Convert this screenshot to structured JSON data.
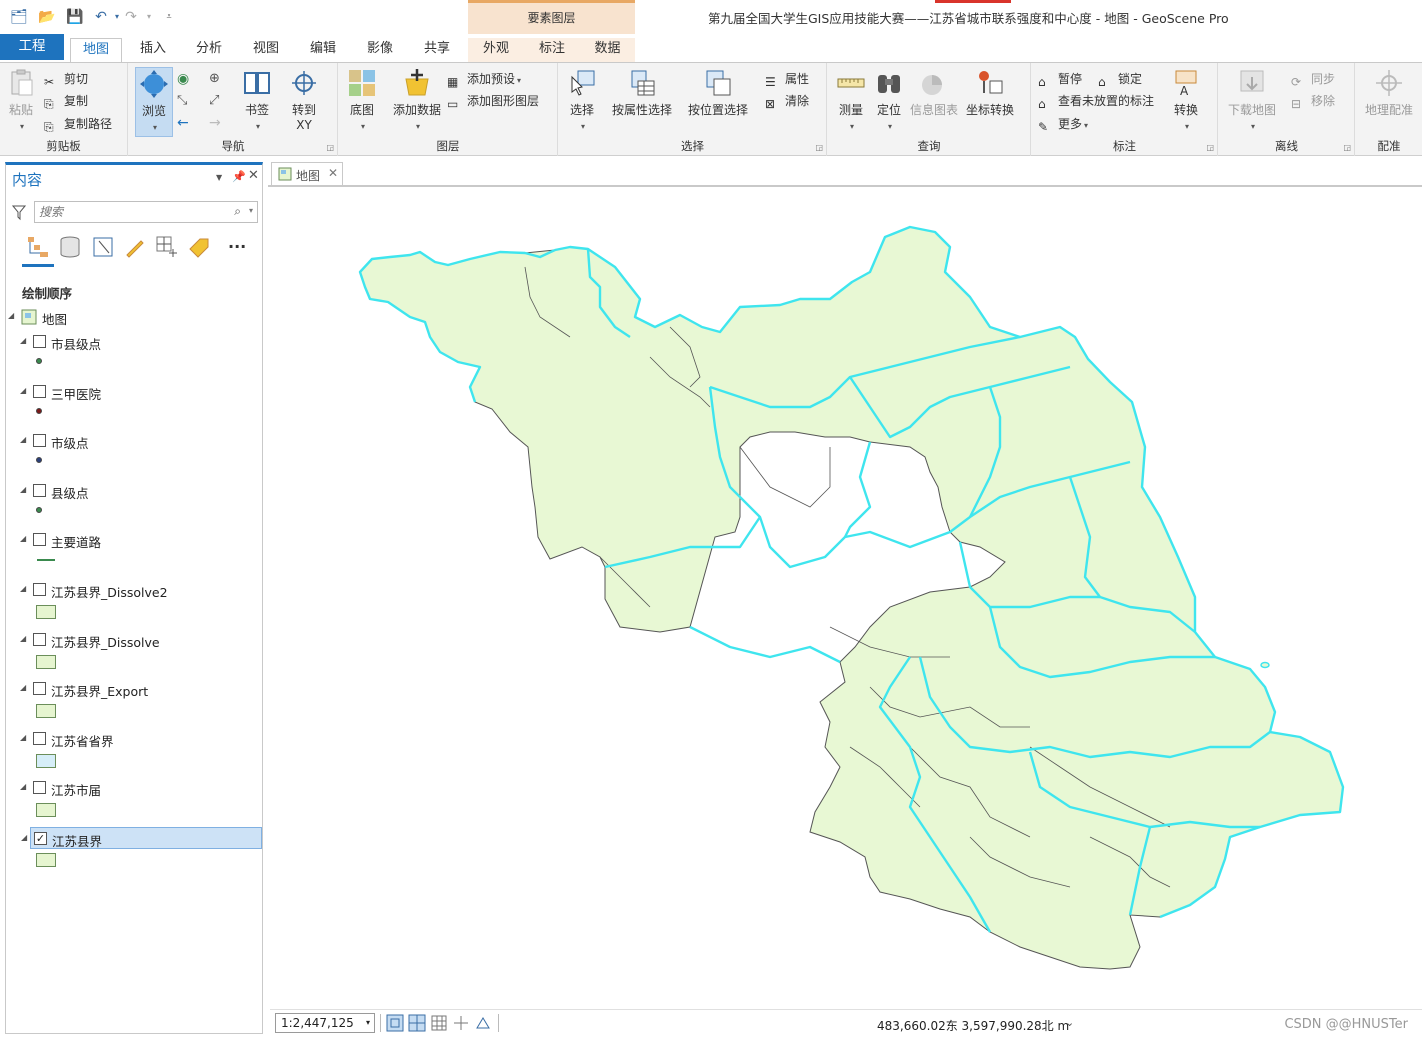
{
  "window": {
    "title": "第九届全国大学生GIS应用技能大赛——江苏省城市联系强度和中心度 - 地图 - GeoScene Pro",
    "contextual_group": "要素图层"
  },
  "tabs": {
    "project": "工程",
    "map": "地图",
    "insert": "插入",
    "analysis": "分析",
    "view": "视图",
    "edit": "编辑",
    "imagery": "影像",
    "share": "共享",
    "appearance": "外观",
    "labeling": "标注",
    "data": "数据"
  },
  "ribbon": {
    "clipboard": {
      "label": "剪贴板",
      "paste": "粘贴",
      "cut": "剪切",
      "copy": "复制",
      "copy_path": "复制路径"
    },
    "navigate": {
      "label": "导航",
      "explore": "浏览",
      "bookmarks": "书签",
      "goto_xy_1": "转到",
      "goto_xy_2": "XY"
    },
    "layer": {
      "label": "图层",
      "basemap": "底图",
      "add_data": "添加数据",
      "add_preset": "添加预设",
      "add_graphics_layer": "添加图形图层"
    },
    "selection": {
      "label": "选择",
      "select": "选择",
      "select_by_attributes": "按属性选择",
      "select_by_location": "按位置选择",
      "attributes": "属性",
      "clear": "清除"
    },
    "inquiry": {
      "label": "查询",
      "measure": "测量",
      "locate": "定位",
      "infographics": "信息图表",
      "convert_coordinates": "坐标转换"
    },
    "labeling": {
      "label": "标注",
      "pause": "暂停",
      "lock": "锁定",
      "view_unplaced": "查看未放置的标注",
      "more": "更多",
      "convert": "转换"
    },
    "offline": {
      "label": "离线",
      "download_map": "下载地图",
      "sync": "同步",
      "remove": "移除"
    },
    "georeference": {
      "label": "配准",
      "georeference": "地理配准"
    }
  },
  "contents": {
    "title": "内容",
    "search_placeholder": "搜索",
    "drawing_order": "绘制顺序",
    "map_name": "地图",
    "layers": [
      {
        "name": "市县级点",
        "checked": false,
        "symbol": "point",
        "color": "#3a8a4e"
      },
      {
        "name": "三甲医院",
        "checked": false,
        "symbol": "point",
        "color": "#7a1a1a"
      },
      {
        "name": "市级点",
        "checked": false,
        "symbol": "point",
        "color": "#2a3f7a"
      },
      {
        "name": "县级点",
        "checked": false,
        "symbol": "point",
        "color": "#3a8a4e"
      },
      {
        "name": "主要道路",
        "checked": false,
        "symbol": "line",
        "color": "#3a8a4e"
      },
      {
        "name": "江苏县界_Dissolve2",
        "checked": false,
        "symbol": "polygon",
        "color": "#e6f5d0"
      },
      {
        "name": "江苏县界_Dissolve",
        "checked": false,
        "symbol": "polygon",
        "color": "#e6f5d0"
      },
      {
        "name": "江苏县界_Export",
        "checked": false,
        "symbol": "polygon",
        "color": "#e6f5d0"
      },
      {
        "name": "江苏省省界",
        "checked": false,
        "symbol": "polygon",
        "color": "#d6eef8"
      },
      {
        "name": "江苏市届",
        "checked": false,
        "symbol": "polygon",
        "color": "#e6f5d0"
      },
      {
        "name": "江苏县界",
        "checked": true,
        "symbol": "polygon",
        "color": "#e6f5d0",
        "selected": true
      }
    ]
  },
  "map_view": {
    "tab_label": "地图",
    "fill_color": "#e8f8d4",
    "city_boundary_color": "#3fe5ee",
    "county_boundary_color": "#555555"
  },
  "status": {
    "scale": "1:2,447,125",
    "coordinates": "483,660.02东 3,597,990.28北 m",
    "watermark": "CSDN @@HNUSTer"
  }
}
